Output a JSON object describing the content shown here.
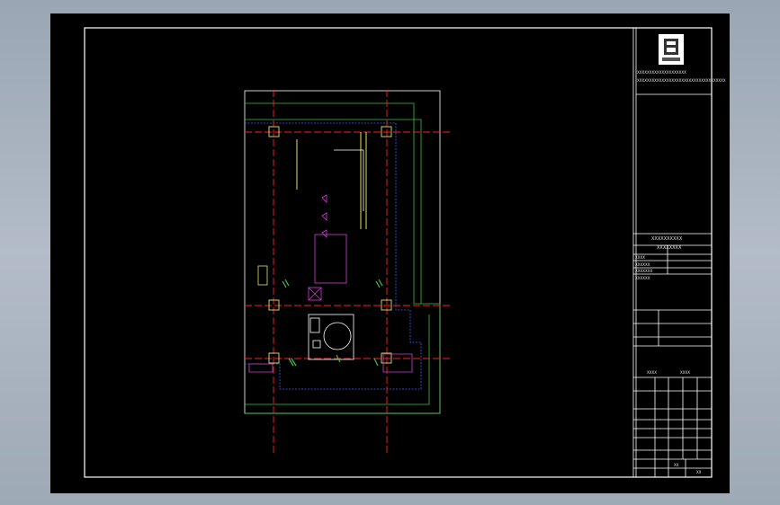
{
  "drawing": {
    "logo_label": "logo",
    "title_block": {
      "company_line": "ХХХХХХХХХХХХХХХХХХХХ",
      "company_subline": "ХХХХХХХХХХХХХХХХХХХХХХХХХХХХХХХХХХХХ",
      "project_line1": "ХХХХХХХХХХ",
      "project_line2": "ХХХХХХХХ",
      "rows_left": [
        "ХХХХ",
        "ХХХХХХ",
        "ХХХХХХХ",
        "ХХХХХХ"
      ],
      "sheet_label_1": "ХХХХ",
      "sheet_label_2": "ХХХХ",
      "scale_label": "ХХ",
      "sheet_no": "ХХ"
    }
  },
  "colors": {
    "background": "#000000",
    "frame": "#ffffff",
    "axis": "#ff2020",
    "blue_dashed": "#4060ff",
    "green": "#40c040",
    "magenta": "#d040d0",
    "yellow": "#e8e060",
    "white_wall": "#ffffff"
  }
}
